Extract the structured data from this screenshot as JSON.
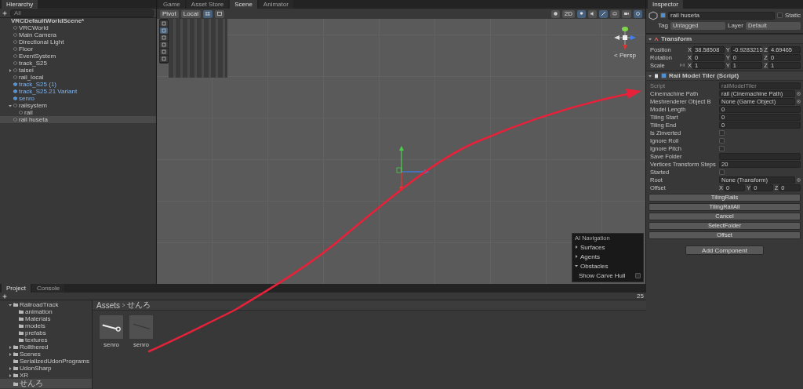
{
  "hierarchy": {
    "title": "Hierarchy",
    "search": {
      "placeholder": "All"
    },
    "scene": "VRCDefaultWorldScene*",
    "items": [
      {
        "label": "VRCWorld",
        "kind": "object",
        "selected": false
      },
      {
        "label": "Main Camera",
        "kind": "object",
        "selected": false
      },
      {
        "label": "Directional Light",
        "kind": "object",
        "selected": false
      },
      {
        "label": "Floor",
        "kind": "object",
        "selected": false
      },
      {
        "label": "EventSystem",
        "kind": "object",
        "selected": false
      },
      {
        "label": "track_S25",
        "kind": "object",
        "selected": false
      },
      {
        "label": "taisei",
        "kind": "object",
        "selected": false,
        "expanded": false
      },
      {
        "label": "rail_local",
        "kind": "object",
        "selected": false
      },
      {
        "label": "track_S25 (1)",
        "kind": "prefab",
        "selected": false
      },
      {
        "label": "track_S25.21 Variant",
        "kind": "prefab",
        "selected": false
      },
      {
        "label": "senro",
        "kind": "prefab",
        "selected": false
      },
      {
        "label": "railsystem",
        "kind": "object",
        "selected": false,
        "expanded": true,
        "children": [
          {
            "label": "rail",
            "kind": "object",
            "selected": false
          }
        ]
      },
      {
        "label": "rail huseta",
        "kind": "object",
        "selected": true
      }
    ]
  },
  "scene_tabs": [
    {
      "label": "Game",
      "selected": false
    },
    {
      "label": "Asset Store",
      "selected": false
    },
    {
      "label": "Scene",
      "selected": true
    },
    {
      "label": "Animator",
      "selected": false
    }
  ],
  "scene_toolbar": {
    "pivot": "Pivot",
    "space": "Local",
    "mode_2d": "2D",
    "toggles": [
      {
        "kind": "lighting",
        "on": true
      },
      {
        "kind": "audio",
        "on": false
      },
      {
        "kind": "effects",
        "on": true
      },
      {
        "kind": "visibility",
        "on": false
      }
    ]
  },
  "gizmo": {
    "label": "< Persp"
  },
  "ai_navigation": {
    "title": "AI Navigation",
    "sections": [
      {
        "label": "Surfaces",
        "expanded": false
      },
      {
        "label": "Agents",
        "expanded": false
      },
      {
        "label": "Obstacles",
        "expanded": true
      }
    ],
    "option": {
      "label": "Show Carve Hull",
      "checked": false
    }
  },
  "inspector": {
    "title": "Inspector",
    "object_name": "rail huseta",
    "active": true,
    "static_label": "Static",
    "static": false,
    "tag_label": "Tag",
    "tag": "Untagged",
    "layer_label": "Layer",
    "layer": "Default",
    "transform": {
      "title": "Transform",
      "rows": [
        {
          "label": "Position",
          "values": [
            {
              "axis": "X",
              "value": "38.58508"
            },
            {
              "axis": "Y",
              "value": "-0.9283215"
            },
            {
              "axis": "Z",
              "value": "4.69465"
            }
          ]
        },
        {
          "label": "Rotation",
          "values": [
            {
              "axis": "X",
              "value": "0"
            },
            {
              "axis": "Y",
              "value": "0"
            },
            {
              "axis": "Z",
              "value": "0"
            }
          ]
        },
        {
          "label": "Scale",
          "linked": true,
          "values": [
            {
              "axis": "X",
              "value": "1"
            },
            {
              "axis": "Y",
              "value": "1"
            },
            {
              "axis": "Z",
              "value": "1"
            }
          ]
        }
      ]
    },
    "component": {
      "title": "Rail Model Tiler (Script)",
      "enabled": true,
      "fields": [
        {
          "kind": "script",
          "label": "Script",
          "value": "railModelTiler"
        },
        {
          "kind": "object",
          "label": "Cinemachine Path",
          "value": "rail (Cinemachine Path)"
        },
        {
          "kind": "object",
          "label": "Meshrenderer Object B",
          "value": "None (Game Object)"
        },
        {
          "kind": "number",
          "label": "Model Length",
          "value": "0"
        },
        {
          "kind": "number",
          "label": "Tiling Start",
          "value": "0"
        },
        {
          "kind": "number",
          "label": "Tiling End",
          "value": "0"
        },
        {
          "kind": "checkbox",
          "label": "Is Zinverted",
          "checked": false
        },
        {
          "kind": "checkbox",
          "label": "Ignore Roll",
          "checked": false
        },
        {
          "kind": "checkbox",
          "label": "Ignore Pitch",
          "checked": false
        },
        {
          "kind": "text",
          "label": "Save Folder"
        },
        {
          "kind": "number",
          "label": "Vertices Transform Steps",
          "value": "20"
        },
        {
          "kind": "checkbox",
          "label": "Started",
          "checked": false
        },
        {
          "kind": "object",
          "label": "Root",
          "value": "None (Transform)"
        },
        {
          "kind": "vector3",
          "label": "Offset",
          "values": [
            {
              "axis": "X",
              "value": "0"
            },
            {
              "axis": "Y",
              "value": "0"
            },
            {
              "axis": "Z",
              "value": "0"
            }
          ]
        }
      ],
      "buttons": [
        "TilingRails",
        "TilingRailAll",
        "Cancel",
        "SelectFolder",
        "Offset"
      ]
    },
    "add_component": "Add Component"
  },
  "project": {
    "tabs": [
      {
        "label": "Project",
        "selected": true
      },
      {
        "label": "Console",
        "selected": false
      }
    ],
    "tree": [
      {
        "label": "RailroadTrack",
        "expanded": true,
        "selected": false,
        "children": [
          {
            "label": "animation",
            "selected": false
          },
          {
            "label": "Materials",
            "selected": false
          },
          {
            "label": "models",
            "selected": false
          },
          {
            "label": "prefabs",
            "selected": false
          },
          {
            "label": "textures",
            "selected": false
          }
        ]
      },
      {
        "label": "Rollthered",
        "expanded": false,
        "selected": false
      },
      {
        "label": "Scenes",
        "expanded": false,
        "selected": false
      },
      {
        "label": "SerializedUdonPrograms",
        "selected": false
      },
      {
        "label": "UdonSharp",
        "expanded": false,
        "selected": false
      },
      {
        "label": "XR",
        "expanded": false,
        "selected": false
      },
      {
        "label": "せんろ",
        "selected": true
      }
    ],
    "breadcrumb": [
      "Assets",
      "せんろ"
    ],
    "assets": [
      {
        "label": "senro",
        "kind": "mesh"
      },
      {
        "label": "senro",
        "kind": "line"
      }
    ],
    "count": "25"
  }
}
